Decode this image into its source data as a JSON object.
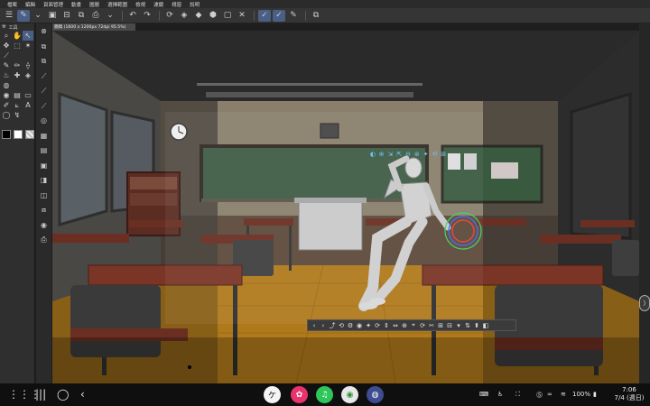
{
  "menu": [
    "檔案",
    "編輯",
    "頁面管理",
    "動畫",
    "圖層",
    "選擇範圍",
    "檢視",
    "濾鏡",
    "視窗",
    "說明"
  ],
  "command_bar": {
    "icons": [
      "menu-icon",
      "pen-icon",
      "chevron-down-icon",
      "gallery-icon",
      "split-icon",
      "layers-icon",
      "print-icon",
      "chevron-down-icon",
      "undo-icon",
      "redo-icon",
      "rotate-icon",
      "fill-icon",
      "eraser-icon",
      "shape-icon",
      "frame-icon",
      "ruler-icon",
      "pen-check-icon",
      "pen-check-icon",
      "pen-edit-icon",
      "export-icon"
    ]
  },
  "tools": {
    "header": "工具",
    "items": [
      {
        "icon": "magnifier-icon",
        "glyph": "⌕"
      },
      {
        "icon": "hand-icon",
        "glyph": "✋"
      },
      {
        "icon": "move-layer-icon",
        "glyph": "↖"
      },
      {
        "icon": "move-icon",
        "glyph": "✥"
      },
      {
        "icon": "selection-icon",
        "glyph": "⬚"
      },
      {
        "icon": "magic-wand-icon",
        "glyph": "✶"
      },
      {
        "icon": "eyedropper-icon",
        "glyph": "⟋"
      },
      {
        "icon": "blank",
        "glyph": ""
      },
      {
        "icon": "blank",
        "glyph": ""
      },
      {
        "icon": "pen-icon",
        "glyph": "✎"
      },
      {
        "icon": "pencil-icon",
        "glyph": "✏"
      },
      {
        "icon": "brush-icon",
        "glyph": "⟠"
      },
      {
        "icon": "airbrush-icon",
        "glyph": "♨"
      },
      {
        "icon": "decoration-icon",
        "glyph": "✚"
      },
      {
        "icon": "eraser-icon",
        "glyph": "◈"
      },
      {
        "icon": "blend-icon",
        "glyph": "◍"
      },
      {
        "icon": "blank",
        "glyph": ""
      },
      {
        "icon": "blank",
        "glyph": ""
      },
      {
        "icon": "fill-icon",
        "glyph": "◉"
      },
      {
        "icon": "gradient-icon",
        "glyph": "▤"
      },
      {
        "icon": "frame-border-icon",
        "glyph": "▭"
      },
      {
        "icon": "figure-icon",
        "glyph": "✐"
      },
      {
        "icon": "ruler-icon",
        "glyph": "⟀"
      },
      {
        "icon": "text-icon",
        "glyph": "A"
      },
      {
        "icon": "balloon-icon",
        "glyph": "◯"
      },
      {
        "icon": "correct-line-icon",
        "glyph": "↯"
      },
      {
        "icon": "blank",
        "glyph": ""
      }
    ],
    "colors": [
      "#000000",
      "#ffffff",
      "#bfbfbf"
    ]
  },
  "subtools": [
    "crosshair-icon",
    "layer-move-icon",
    "layer-copy-icon",
    "line-icon",
    "line-icon",
    "line-icon",
    "circle-target-icon",
    "grid-icon",
    "panel-icon",
    "panel-icon",
    "panel-icon",
    "panel-icon",
    "panel-icon",
    "panel-icon",
    "camera-icon"
  ],
  "canvas": {
    "tab_label": "圖稿 (1600 x 1200px 72dpi 95.5%)"
  },
  "transform_toolbar": {
    "glyphs": [
      "‹",
      "›",
      "⤴",
      "⟲",
      "⚙",
      "◉",
      "✦",
      "⟳",
      "⇕",
      "⇔",
      "⊕",
      "⌖",
      "⟳",
      "✂",
      "⊞",
      "⊟",
      "▾",
      "⇅",
      "⬍",
      "◧"
    ]
  },
  "manipulator": {
    "glyphs": [
      "◐",
      "⊕",
      "⇲",
      "⇱",
      "⊖",
      "⊛",
      "✦",
      "⟲",
      "⊞"
    ]
  },
  "navbar": {
    "apps": [
      {
        "name": "app-clip-studio",
        "color": "#f5f5f5",
        "glyph": "ケ",
        "fg": "#111"
      },
      {
        "name": "app-blossom",
        "color": "#e8336d",
        "glyph": "✿",
        "fg": "#fff"
      },
      {
        "name": "app-music",
        "color": "#2ec65a",
        "glyph": "♫",
        "fg": "#fff"
      },
      {
        "name": "app-chrome",
        "color": "#e9e9e9",
        "glyph": "◉",
        "fg": "#2a8f3a"
      },
      {
        "name": "app-galaxy",
        "color": "#3d4d8f",
        "glyph": "◍",
        "fg": "#fff"
      }
    ],
    "battery": "100%",
    "time": "7:06",
    "date": "7/4 (週日)"
  }
}
